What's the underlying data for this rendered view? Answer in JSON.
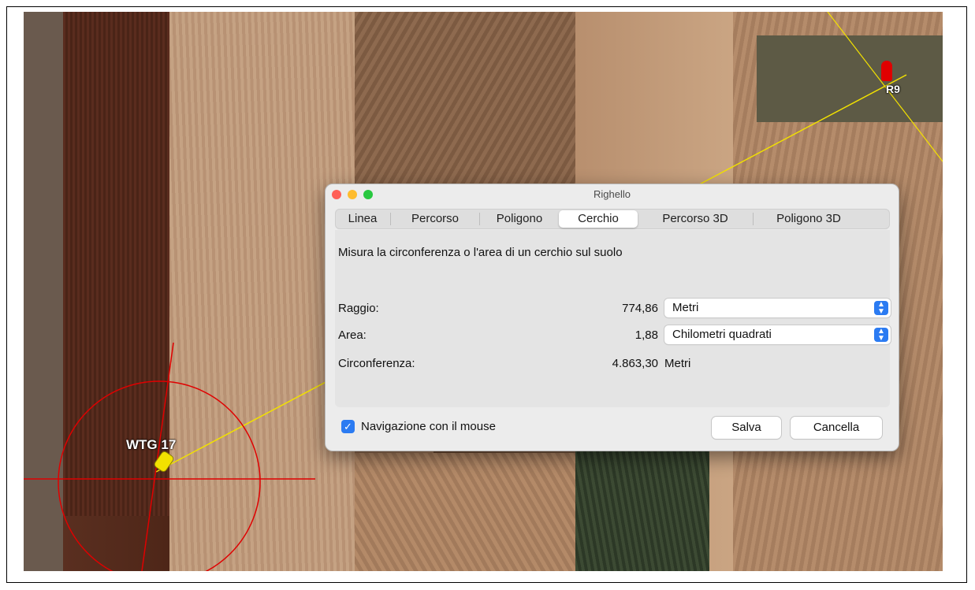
{
  "window": {
    "title": "Righello"
  },
  "tabs": [
    {
      "label": "Linea"
    },
    {
      "label": "Percorso"
    },
    {
      "label": "Poligono"
    },
    {
      "label": "Cerchio",
      "active": true
    },
    {
      "label": "Percorso 3D"
    },
    {
      "label": "Poligono 3D"
    }
  ],
  "description": "Misura la circonferenza o l'area di un cerchio sul suolo",
  "measurements": {
    "radius": {
      "label": "Raggio:",
      "value": "774,86",
      "unit": "Metri"
    },
    "area": {
      "label": "Area:",
      "value": "1,88",
      "unit": "Chilometri quadrati"
    },
    "circumference": {
      "label": "Circonferenza:",
      "value": "4.863,30",
      "unit": "Metri"
    }
  },
  "footer": {
    "mouse_nav_label": "Navigazione con il mouse",
    "mouse_nav_checked": true,
    "save_label": "Salva",
    "cancel_label": "Cancella"
  },
  "map": {
    "placemark_label": "WTG 17",
    "person_label": "R9"
  },
  "colors": {
    "accent": "#2b7bf2",
    "measure_line": "#f2e100",
    "circle": "#e00000",
    "close": "#ff5f57",
    "minimize": "#febc2e",
    "maximize": "#28c840"
  }
}
